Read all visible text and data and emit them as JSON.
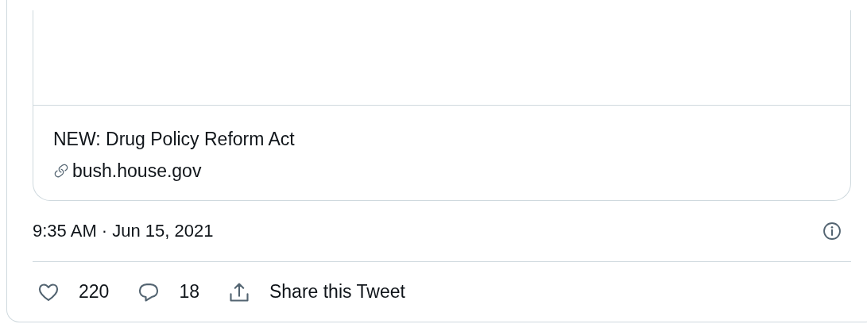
{
  "link_card": {
    "title": "NEW: Drug Policy Reform Act",
    "domain": "bush.house.gov"
  },
  "timestamp": "9:35 AM · Jun 15, 2021",
  "actions": [
    {
      "kind": "like",
      "label": "220"
    },
    {
      "kind": "reply",
      "label": "18"
    },
    {
      "kind": "share",
      "label": "Share this Tweet"
    }
  ]
}
